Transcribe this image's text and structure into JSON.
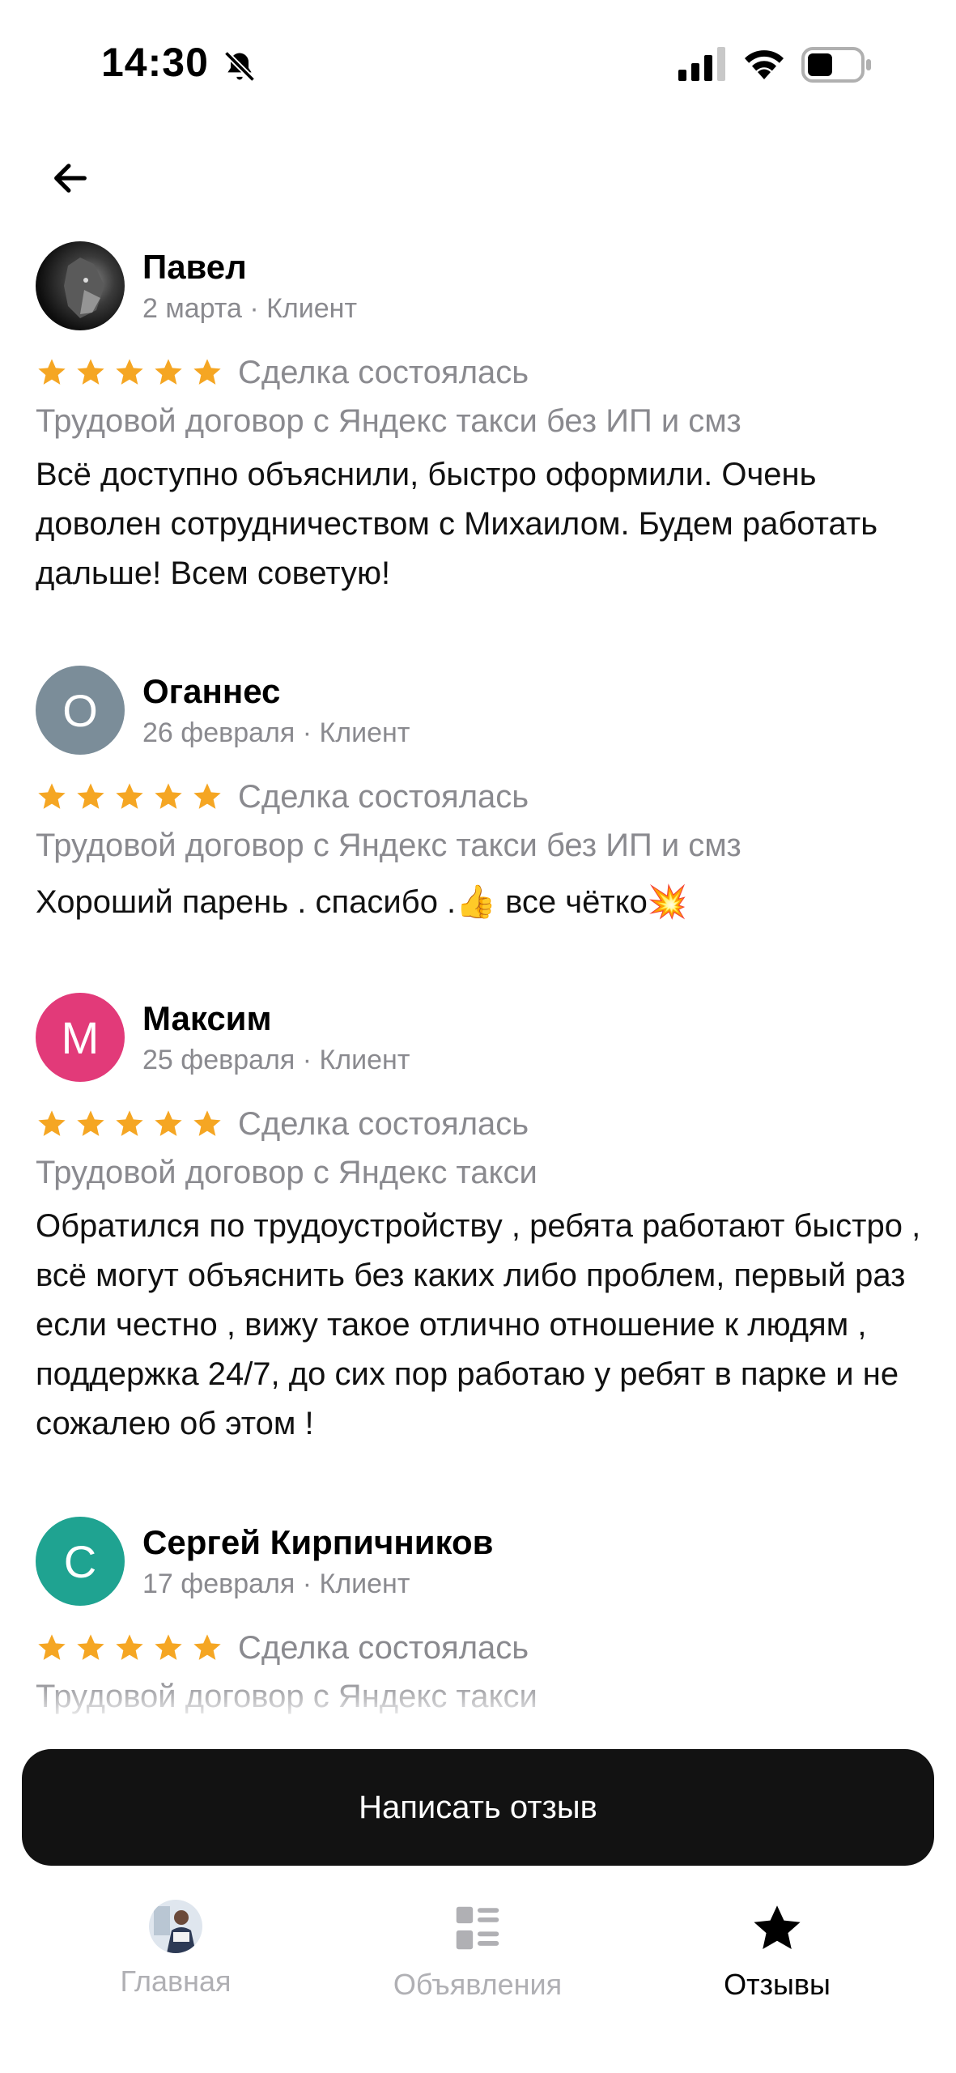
{
  "status_bar": {
    "time": "14:30"
  },
  "reviews": [
    {
      "name": "Павел",
      "meta": "2 марта · Клиент",
      "avatar_letter": "",
      "avatar_color": "#1a1a1a",
      "deal_status": "Сделка состоялась",
      "service": "Трудовой договор с Яндекс такси без ИП и смз",
      "text": "Всё доступно объяснили, быстро оформили. Очень доволен сотрудничеством с Михаилом. Будем работать дальше! Всем советую!"
    },
    {
      "name": "Оганнес",
      "meta": "26 февраля · Клиент",
      "avatar_letter": "О",
      "avatar_color": "#7b8d99",
      "deal_status": "Сделка состоялась",
      "service": "Трудовой договор с Яндекс такси без ИП и смз",
      "text": "Хороший парень . спасибо .👍 все чётко💥"
    },
    {
      "name": "Максим",
      "meta": "25 февраля · Клиент",
      "avatar_letter": "М",
      "avatar_color": "#e23a79",
      "deal_status": "Сделка состоялась",
      "service": "Трудовой договор с Яндекс такси",
      "text": "Обратился по трудоустройству , ребята работают быстро , всё могут объяснить без каких либо проблем, первый раз если честно , вижу такое отлично отношение к людям , поддержка 24/7, до сих пор работаю у ребят в парке и не сожалею об этом !"
    },
    {
      "name": "Сергей Кирпичников",
      "meta": "17 февраля · Клиент",
      "avatar_letter": "С",
      "avatar_color": "#1fa391",
      "deal_status": "Сделка состоялась",
      "service": "Трудовой договор с Яндекс такси",
      "text": ""
    }
  ],
  "rating_stars": 5,
  "colors": {
    "star": "#f5a623",
    "muted": "#8a8a8f",
    "button_bg": "#121212"
  },
  "write_review_button": "Написать отзыв",
  "tabbar": {
    "home": {
      "label": "Главная",
      "icon": "profile-photo-icon"
    },
    "ads": {
      "label": "Объявления",
      "icon": "listings-icon"
    },
    "reviews": {
      "label": "Отзывы",
      "icon": "star-icon",
      "active": true
    }
  }
}
